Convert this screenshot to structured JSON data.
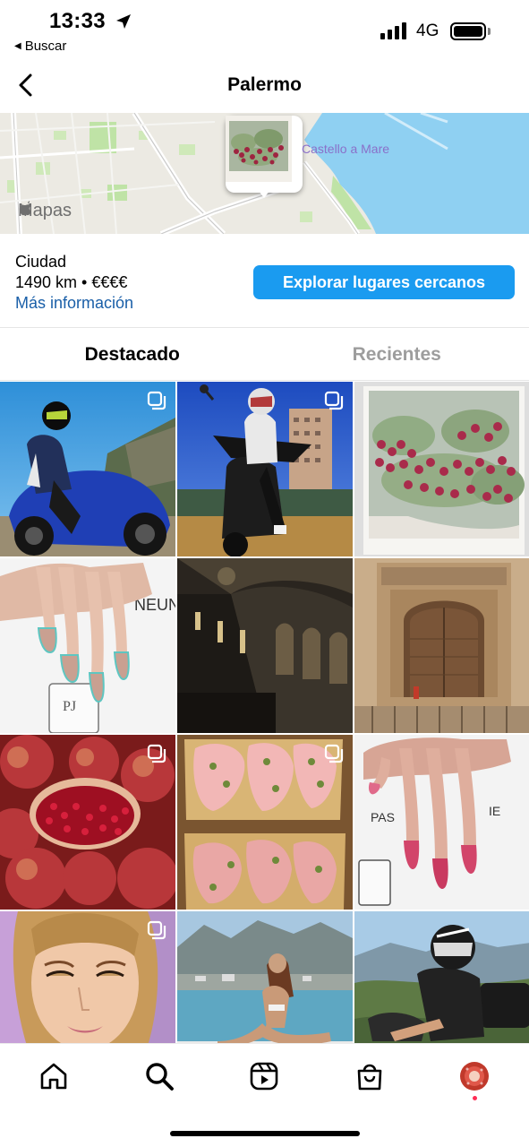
{
  "status_bar": {
    "time": "13:33",
    "back_app": "Buscar",
    "network": "4G"
  },
  "header": {
    "title": "Palermo"
  },
  "map": {
    "brand": "Mapas",
    "place_label": "Castello a Mare"
  },
  "info": {
    "category": "Ciudad",
    "distance_price": "1490 km • €€€€",
    "more_link": "Más información",
    "explore_button": "Explorar lugares cercanos"
  },
  "tabs": [
    {
      "label": "Destacado",
      "active": true
    },
    {
      "label": "Recientes",
      "active": false
    }
  ],
  "grid": [
    {
      "subject": "motorcycle rider blue bike",
      "multi": true
    },
    {
      "subject": "scooter rider at dusk",
      "multi": true
    },
    {
      "subject": "prickly pear polaroid",
      "multi": false
    },
    {
      "subject": "nude teal manicure",
      "multi": false
    },
    {
      "subject": "baroque theatre interior",
      "multi": false
    },
    {
      "subject": "church portal",
      "multi": false
    },
    {
      "subject": "pomegranates",
      "multi": true
    },
    {
      "subject": "focaccia with mortadella",
      "multi": true
    },
    {
      "subject": "pink ombre manicure",
      "multi": false
    },
    {
      "subject": "makeup portrait",
      "multi": true
    },
    {
      "subject": "woman on boat",
      "multi": false
    },
    {
      "subject": "rider with helmet on mountain",
      "multi": false
    }
  ],
  "tabbar": [
    "home-icon",
    "search-icon",
    "reels-icon",
    "shop-icon",
    "profile-avatar"
  ],
  "colors": {
    "accent": "#1a9bf0",
    "link": "#1a5fa8",
    "inactive_tab": "#9d9d9d"
  }
}
